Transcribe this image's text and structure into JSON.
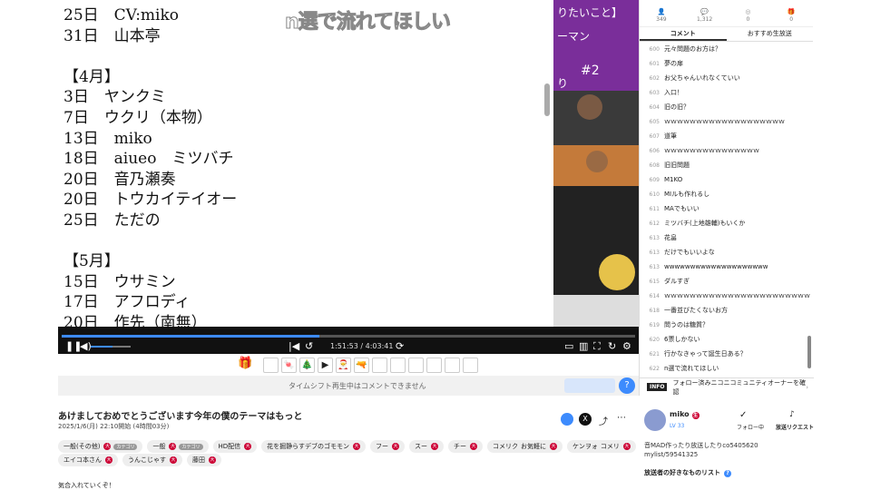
{
  "player": {
    "document_lines": [
      "25日　CV:miko",
      "31日　山本亭",
      "",
      "【4月】",
      "3日　ヤンクミ",
      "7日　ウクリ（本物）",
      "13日　miko",
      "18日　aiueo　ミツバチ",
      "20日　音乃瀬奏",
      "20日　トウカイテイオー",
      "25日　ただの",
      "",
      "【5月】",
      "15日　ウサミン",
      "17日　アフロディ",
      "20日　作先（南無）"
    ],
    "overlay_comment": "n選で流れてほしい",
    "collage_texts": [
      "りたいこと】",
      "ーマン",
      "#2",
      "り"
    ],
    "time_display": "1:51:53 / 4:03:41",
    "progress_fraction": 0.45
  },
  "gift_bar": {
    "slots": [
      "",
      "🍬",
      "🎄",
      "▶",
      "🎅",
      "🔫",
      "",
      "",
      "",
      "",
      "",
      ""
    ]
  },
  "notice": {
    "text": "タイムシフト再生中はコメントできません",
    "help_icon": "help-icon"
  },
  "sidebar": {
    "stats": [
      {
        "icon": "viewers-icon",
        "value": "349"
      },
      {
        "icon": "comments-icon",
        "value": "1,312"
      },
      {
        "icon": "ad-icon",
        "value": "0"
      },
      {
        "icon": "gift-icon",
        "value": "0"
      }
    ],
    "tabs": [
      "コメント",
      "おすすめ生放送"
    ],
    "comments": [
      {
        "no": "600",
        "text": "元々問題のお方は？"
      },
      {
        "no": "601",
        "text": "夢の扉"
      },
      {
        "no": "602",
        "text": "お父ちゃんいれなくていい"
      },
      {
        "no": "603",
        "text": "入口！"
      },
      {
        "no": "604",
        "text": "旧の旧？"
      },
      {
        "no": "605",
        "text": "ｗｗｗｗｗｗｗｗｗｗｗｗｗｗｗｗｗｗｗ"
      },
      {
        "no": "607",
        "text": "道筆"
      },
      {
        "no": "606",
        "text": "ｗｗｗｗｗｗｗｗｗｗｗｗｗｗｗ"
      },
      {
        "no": "608",
        "text": "旧旧問題"
      },
      {
        "no": "609",
        "text": "M1KO"
      },
      {
        "no": "610",
        "text": "MIルも作れるし"
      },
      {
        "no": "611",
        "text": "MAでもいい"
      },
      {
        "no": "612",
        "text": "ミツバチ(上地雄輔)もいくか"
      },
      {
        "no": "613",
        "text": "花畠"
      },
      {
        "no": "613",
        "text": "だけでもいいよな"
      },
      {
        "no": "613",
        "text": "wwwwwwwwwwwwwwwwwwww"
      },
      {
        "no": "615",
        "text": "ダルすぎ"
      },
      {
        "no": "614",
        "text": "ｗｗｗｗｗｗｗｗｗｗｗｗｗｗｗｗｗｗｗｗｗｗｗ"
      },
      {
        "no": "618",
        "text": "一番並びたくないお方"
      },
      {
        "no": "619",
        "text": "問うのは糖質？"
      },
      {
        "no": "620",
        "text": "6票しかない"
      },
      {
        "no": "621",
        "text": "行かなきゃって誕生日ある？"
      },
      {
        "no": "622",
        "text": "n選で流れてほしい"
      }
    ],
    "info_tag": "INFO",
    "info_text": "フォロー済みニコニコミュニティオーナーを確認"
  },
  "stream": {
    "title": "あけましておめでとうございます今年の僕のテーマはもっと",
    "date": "2025/1/6(月) 22:10開始 (4時間03分)",
    "tags_row1": [
      {
        "label": "一般(その他)",
        "cat": "カテゴリ"
      },
      {
        "label": "一般",
        "cat": "カテゴリ"
      },
      {
        "label": "HD配信"
      },
      {
        "label": "花を掘静らすデブのゴモモン"
      },
      {
        "label": "フー"
      },
      {
        "label": "スー"
      },
      {
        "label": "チー"
      },
      {
        "label": "コメリク"
      },
      {
        "label": "ケンヲォ"
      }
    ],
    "tags_row1_notes": [
      "",
      "",
      "",
      "",
      "",
      "",
      "",
      "お気軽に",
      "コメリ"
    ],
    "tags_row2": [
      {
        "label": "エイコ本さん"
      },
      {
        "label": "うんこじゃす"
      },
      {
        "label": "藤田"
      }
    ],
    "description": "気合入れていくぞ！"
  },
  "broadcaster": {
    "name": "miko",
    "level": "LV 33",
    "follow_label": "フォロー中",
    "request_label": "放送リクエスト",
    "bio": "音MAD作ったり放送したりco5405620　mylist/59541325",
    "favorites_heading": "放送者の好きなものリスト"
  },
  "colors": {
    "accent": "#3d8bfd",
    "badge": "#cc0033"
  }
}
